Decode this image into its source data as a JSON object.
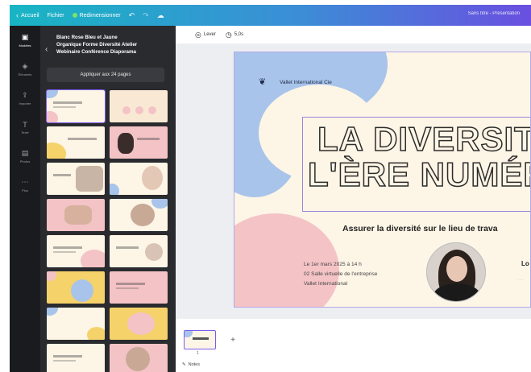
{
  "topbar": {
    "home_label": "Accueil",
    "file_label": "Fichier",
    "resize_label": "Redimensionner",
    "undo_icon": "undo-icon",
    "redo_icon": "redo-icon",
    "cloud_icon": "cloud-save-icon",
    "right_title": "Sans titre - Présentation"
  },
  "rail": {
    "items": [
      {
        "label": "Modèles",
        "icon": "template-icon"
      },
      {
        "label": "Éléments",
        "icon": "elements-icon"
      },
      {
        "label": "Importer",
        "icon": "upload-icon"
      },
      {
        "label": "Texte",
        "icon": "text-icon"
      },
      {
        "label": "Photos",
        "icon": "photo-icon"
      },
      {
        "label": "Plus",
        "icon": "more-icon"
      }
    ]
  },
  "panel": {
    "title_lines": [
      "Blanc Rose Bleu et Jaune",
      "Organique Forme Diversité Atelier",
      "Webinaire Conférence Diaporama"
    ],
    "apply_label": "Appliquer aux 24 pages"
  },
  "canvas_toolbar": {
    "animate_label": "Lever",
    "duration_label": "5,0s"
  },
  "slide": {
    "logo_text": "Vallet International Cie",
    "title_line1": "LA DIVERSITÉ",
    "title_line2": "L'ÈRE NUMÉRIC",
    "subtitle": "Assurer la diversité sur le lieu de trava",
    "info_lines": [
      "Le 1er mars 2025 à 14 h",
      "02 Salle virtuelle de l'entreprise",
      "Vallet International"
    ],
    "speaker_name": "Lo"
  },
  "pager": {
    "page_number": "1",
    "notes_label": "Notes"
  },
  "colors": {
    "accent": "#7c5cf0",
    "blue_blob": "#a8c4ea",
    "pink_blob": "#f4c3c6",
    "yellow_blob": "#f6d26b",
    "cream": "#fdf5e6"
  }
}
